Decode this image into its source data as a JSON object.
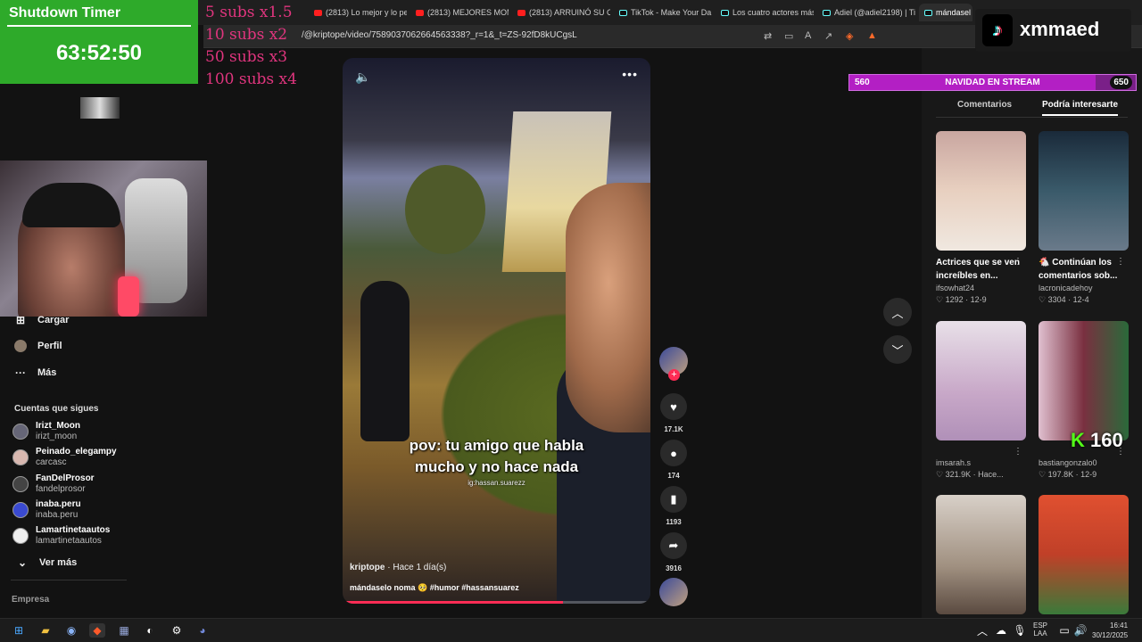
{
  "browser": {
    "tabs": [
      {
        "label": "(2813) Lo mejor y lo pe",
        "kind": "youtube"
      },
      {
        "label": "(2813) MEJORES MOM",
        "kind": "youtube"
      },
      {
        "label": "(2813) ARRUINÓ SU C",
        "kind": "youtube"
      },
      {
        "label": "TikTok - Make Your Da",
        "kind": "tiktok"
      },
      {
        "label": "Los cuatro actores más",
        "kind": "tiktok"
      },
      {
        "label": "Adiel (@adiel2198) | Ti",
        "kind": "tiktok"
      },
      {
        "label": "mándasel",
        "kind": "tiktok"
      }
    ],
    "url": "/@kriptope/video/7589037062664563338?_r=1&_t=ZS-92fD8kUCgsL"
  },
  "overlay": {
    "timer_title": "Shutdown Timer",
    "timer_value": "63:52:50",
    "subs_rules": [
      "5 subs x1.5",
      "10 subs x2",
      "50 subs x3",
      "100 subs x4"
    ],
    "goal": {
      "left": "560",
      "title": "NAVIDAD EN STREAM",
      "right": "650",
      "fill_fraction": 0.86
    },
    "kick_count": "160",
    "logo_name": "xmmaed"
  },
  "sidebar": {
    "items": [
      {
        "label": "Cargar",
        "icon": "upload-icon"
      },
      {
        "label": "Perfil",
        "icon": "profile-icon"
      },
      {
        "label": "Más",
        "icon": "more-icon"
      }
    ],
    "following_title": "Cuentas que sigues",
    "following": [
      {
        "name": "Irizt_Moon",
        "handle": "irizt_moon"
      },
      {
        "name": "Peinado_elegampy",
        "handle": "carcasc"
      },
      {
        "name": "FanDelProsor",
        "handle": "fandelprosor"
      },
      {
        "name": "inaba.peru",
        "handle": "inaba.peru"
      },
      {
        "name": "Lamartinetaautos",
        "handle": "lamartinetaautos"
      }
    ],
    "see_more": "Ver más",
    "footer": "Empresa"
  },
  "video": {
    "caption_line1": "pov: tu amigo que habla",
    "caption_line2": "mucho y no hace nada",
    "ig_tag": "ig:hassan.suarezz",
    "author": "kriptope",
    "time": "· Hace 1 día(s)",
    "description": "mándaselo noma 🥺 #humor #hassansuarez",
    "progress": 0.72
  },
  "actions": {
    "likes": "17.1K",
    "comments": "174",
    "saves": "1193",
    "shares": "3916"
  },
  "right_panel": {
    "tab_comments": "Comentarios",
    "tab_suggested": "Podría interesarte",
    "cards": [
      {
        "title": "Actrices que se ven increíbles en...",
        "author": "ifsowhat24",
        "likes": "1292",
        "date": "12-9",
        "color": "#c9a6a0"
      },
      {
        "title": "🐔 Continúan los comentarios sob...",
        "author": "lacronicadehoy",
        "likes": "3304",
        "date": "12-4",
        "color": "#3a5a6a"
      },
      {
        "title": "",
        "author": "imsarah.s",
        "likes": "321.9K",
        "date": "Hace...",
        "color": "#c8a8c8"
      },
      {
        "title": "",
        "author": "bastiangonzalo0",
        "likes": "197.8K",
        "date": "12-9",
        "color": "#7a3040"
      },
      {
        "title": "",
        "author": "",
        "likes": "",
        "date": "",
        "color": "#a09080"
      },
      {
        "title": "",
        "author": "",
        "likes": "",
        "date": "",
        "color": "#c04028"
      }
    ]
  },
  "taskbar": {
    "lang": "ESP",
    "layout": "LAA",
    "time": "16:41",
    "date": "30/12/2025"
  }
}
